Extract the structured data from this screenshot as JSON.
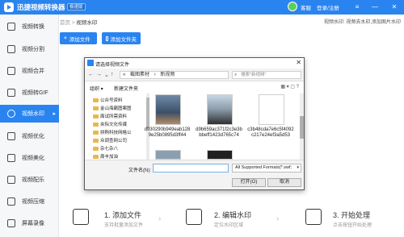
{
  "app": {
    "title": "迅捷视频转换器",
    "badge": "极速版"
  },
  "titlebar": {
    "items": [
      "客服",
      "登录/注册"
    ],
    "buttons": [
      "≡",
      "—",
      "✕"
    ]
  },
  "sidebar": {
    "items": [
      {
        "label": "视频转换",
        "active": false
      },
      {
        "label": "视频分割",
        "active": false
      },
      {
        "label": "视频合并",
        "active": false
      },
      {
        "label": "视频转GIF",
        "active": false
      },
      {
        "label": "视频水印",
        "active": true
      },
      {
        "label": "视频优化",
        "active": false
      },
      {
        "label": "视频美化",
        "active": false
      },
      {
        "label": "视频配乐",
        "active": false
      },
      {
        "label": "视频压缩",
        "active": false
      },
      {
        "label": "屏幕录像",
        "active": false
      }
    ]
  },
  "main": {
    "breadcrumb": {
      "home": "首页",
      "sep": ">",
      "current": "视频水印"
    },
    "right_info": "视频水印: 视频去水印,添加图片水印",
    "add_file_label": "添加文件",
    "add_folder_label": "添加文件夹"
  },
  "dialog": {
    "title": "请选择视频文件",
    "path": [
      "«",
      "截图素材",
      "›",
      "新视频"
    ],
    "search_placeholder": "搜索\"新视频\"",
    "organize": "组织 ▾",
    "new_folder": "新建文件夹",
    "tree": [
      "公众号资料",
      "金山海霸图案图",
      "面试所需资料",
      "央际文化传媒",
      "拼购科技网格公",
      "众调查网公司",
      "杂七杂八",
      "周丰加油"
    ],
    "files": [
      {
        "name": "d930290b949eab1289e25b0895d3ff44"
      },
      {
        "name": "d9b659ac371f2c3e3bbbeff1423d765c74"
      },
      {
        "name": "c3b48cda7e6c5f4092c217e24ef3a5d53"
      }
    ],
    "filename_label": "文件名(N):",
    "filetype": "All Supported Formats(*.swf;",
    "open_label": "打开(O)",
    "cancel_label": "取消"
  },
  "steps": [
    {
      "title": "1. 添加文件",
      "sub": "支持批量添加文件"
    },
    {
      "title": "2. 编辑水印",
      "sub": "定位水印区域"
    },
    {
      "title": "3. 开始处理",
      "sub": "点击按钮开始处理"
    }
  ],
  "colors": {
    "accent": "#2a84f0",
    "sidebar_bg": "#f6f7f9"
  }
}
